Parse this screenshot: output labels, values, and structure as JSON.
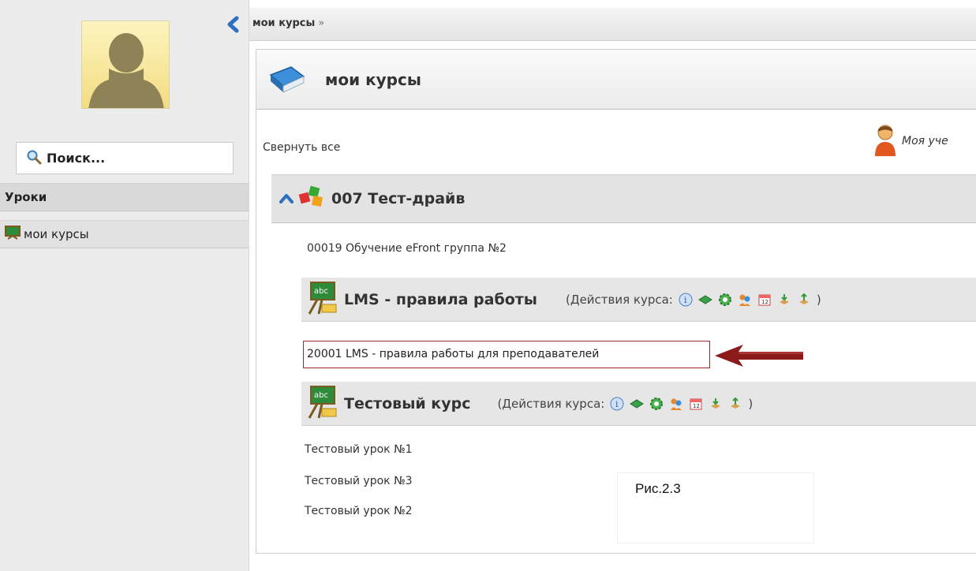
{
  "sidebar": {
    "search_placeholder": "Поиск...",
    "section_heading": "Уроки",
    "items": [
      {
        "label": "мои курсы"
      }
    ]
  },
  "breadcrumb": {
    "label": "мои курсы",
    "separator": "»"
  },
  "panel": {
    "title": "мои курсы",
    "collapse_all": "Свернуть все",
    "account_link": "Моя уче"
  },
  "group": {
    "title": "007 Тест-драйв",
    "subtitle": "00019 Обучение eFront группа №2"
  },
  "courses": [
    {
      "title": "LMS - правила работы",
      "actions_label": "(Действия курса:",
      "actions_close": ")",
      "lessons": [
        "20001 LMS - правила работы для преподавателей"
      ]
    },
    {
      "title": "Тестовый курс",
      "actions_label": "(Действия курса:",
      "actions_close": ")",
      "lessons": [
        "Тестовый урок №1",
        "Тестовый урок №3",
        "Тестовый урок №2"
      ]
    }
  ],
  "figure_caption": "Рис.2.3",
  "colors": {
    "highlight_border": "#9a2a2a",
    "arrow": "#8b1a1a",
    "chevron": "#2d6fc1"
  }
}
